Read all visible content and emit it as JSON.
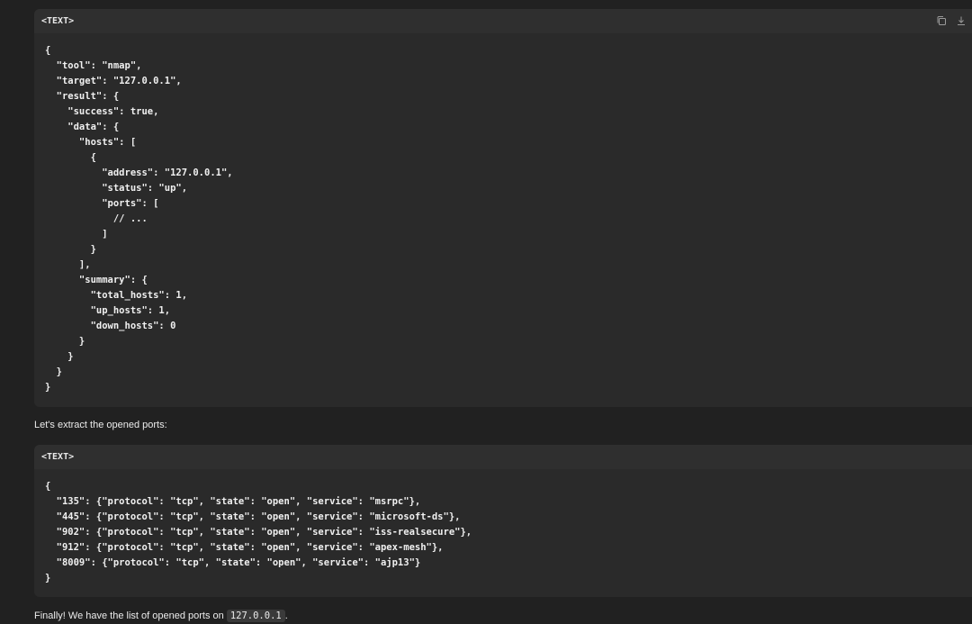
{
  "block1": {
    "lang": "<TEXT>",
    "code": "{\n  \"tool\": \"nmap\",\n  \"target\": \"127.0.0.1\",\n  \"result\": {\n    \"success\": true,\n    \"data\": {\n      \"hosts\": [\n        {\n          \"address\": \"127.0.0.1\",\n          \"status\": \"up\",\n          \"ports\": [\n            // ...\n          ]\n        }\n      ],\n      \"summary\": {\n        \"total_hosts\": 1,\n        \"up_hosts\": 1,\n        \"down_hosts\": 0\n      }\n    }\n  }\n}"
  },
  "prose1": "Let's extract the opened ports:",
  "block2": {
    "lang": "<TEXT>",
    "code": "{\n  \"135\": {\"protocol\": \"tcp\", \"state\": \"open\", \"service\": \"msrpc\"},\n  \"445\": {\"protocol\": \"tcp\", \"state\": \"open\", \"service\": \"microsoft-ds\"},\n  \"902\": {\"protocol\": \"tcp\", \"state\": \"open\", \"service\": \"iss-realsecure\"},\n  \"912\": {\"protocol\": \"tcp\", \"state\": \"open\", \"service\": \"apex-mesh\"},\n  \"8009\": {\"protocol\": \"tcp\", \"state\": \"open\", \"service\": \"ajp13\"}\n}"
  },
  "prose2": {
    "text": "Finally! We have the list of opened ports on",
    "code": "127.0.0.1",
    "end": "."
  },
  "icons": {
    "copy": "copy-icon",
    "download": "download-icon"
  }
}
